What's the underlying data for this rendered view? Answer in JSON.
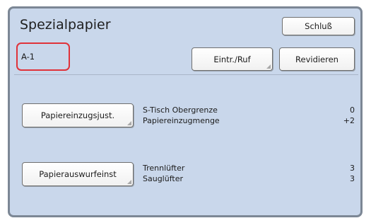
{
  "screen": {
    "title": "Spezialpapier",
    "close_label": "Schluß",
    "field_value": "A-1",
    "entry_label": "Eintr./Ruf",
    "revise_label": "Revidieren"
  },
  "sections": [
    {
      "button_label": "Papiereinzugsjust.",
      "rows": [
        {
          "label": "S-Tisch Obergrenze",
          "value": "0"
        },
        {
          "label": "Papiereinzugmenge",
          "value": "+2"
        }
      ]
    },
    {
      "button_label": "Papierauswurfeinst",
      "rows": [
        {
          "label": "Trennlüfter",
          "value": "3"
        },
        {
          "label": "Sauglüfter",
          "value": "3"
        }
      ]
    }
  ],
  "colors": {
    "panel": "#c9d7eb",
    "field_border": "#e0323a"
  }
}
